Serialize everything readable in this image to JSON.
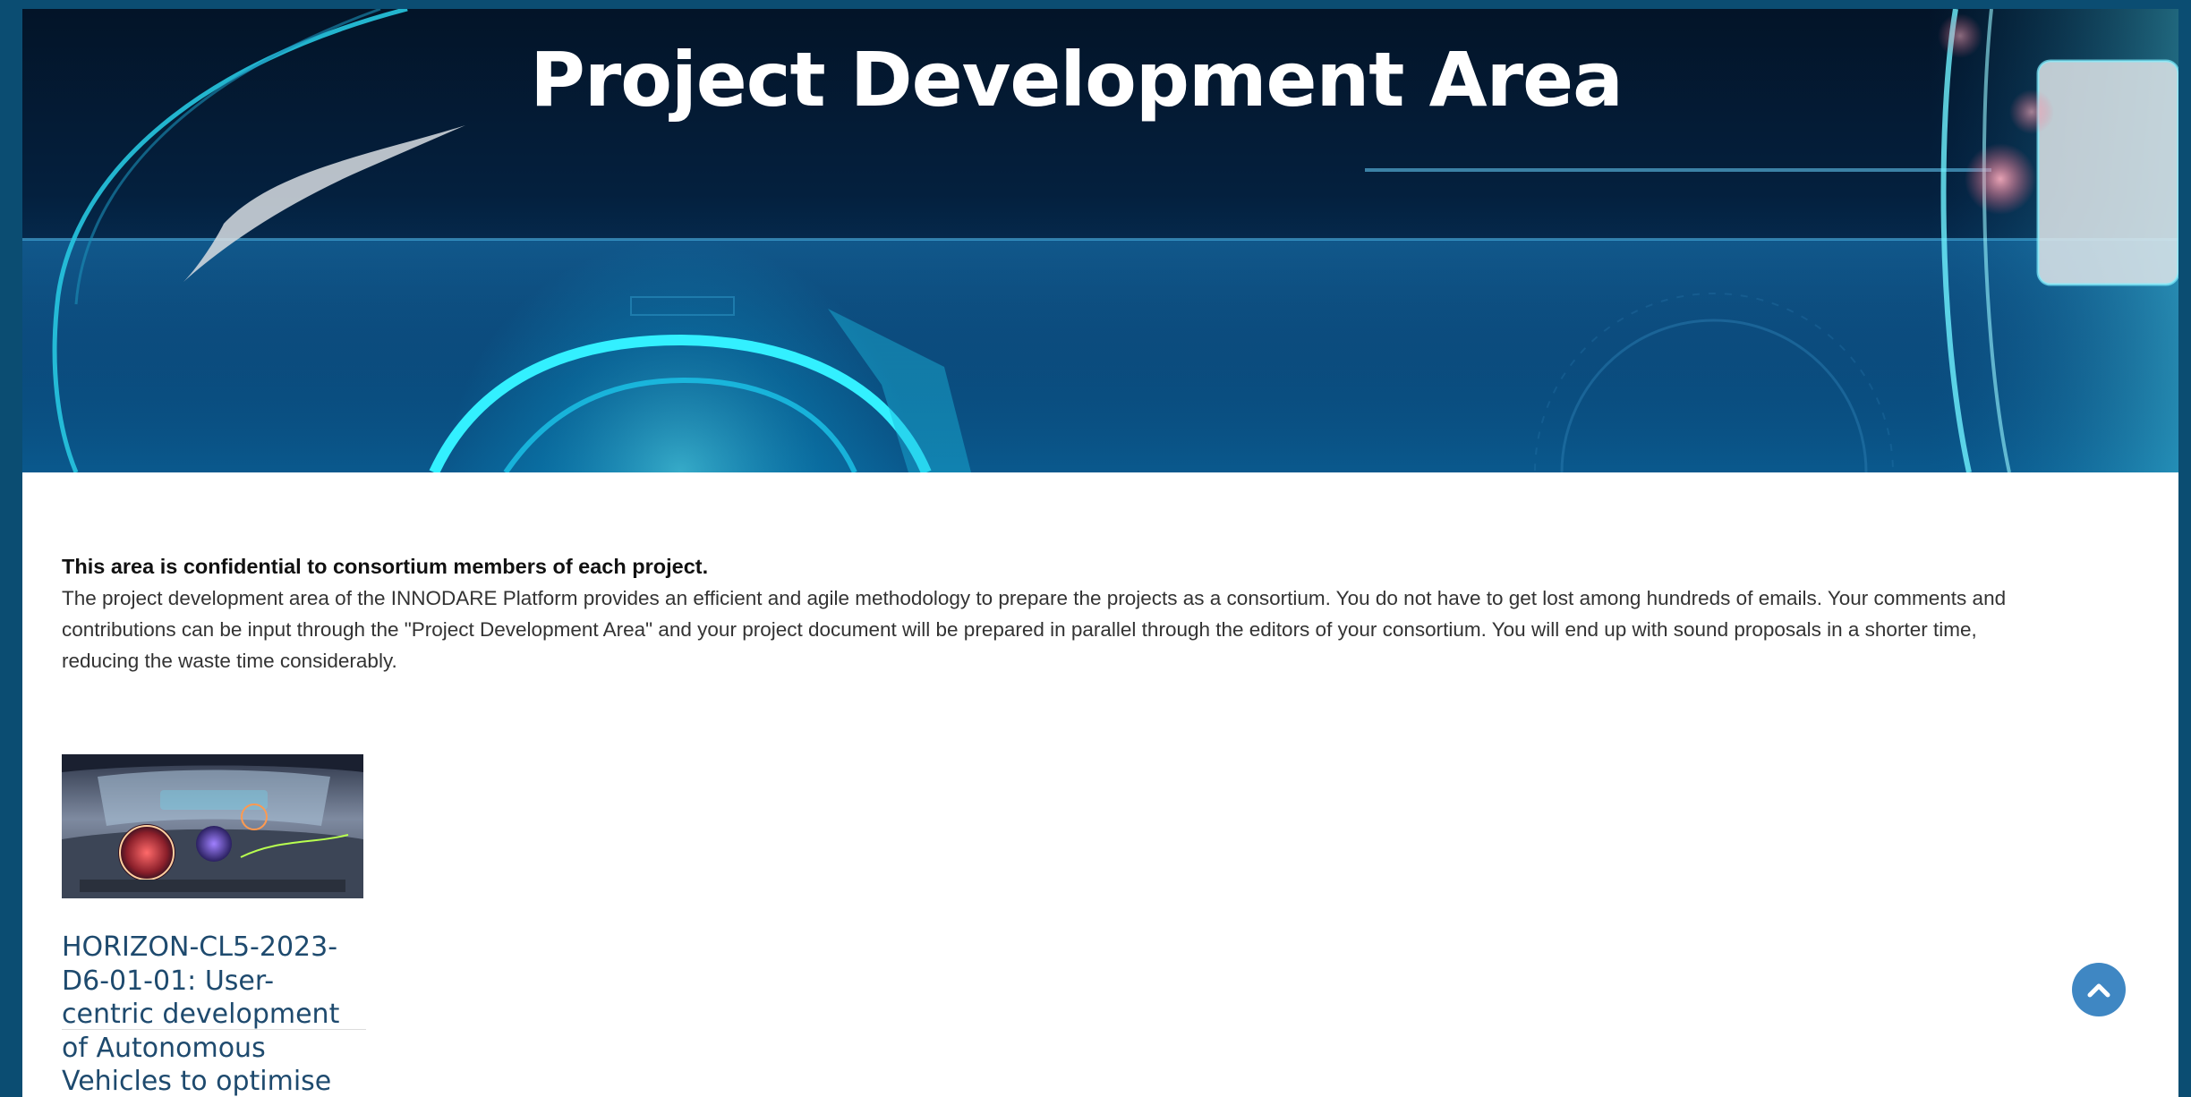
{
  "hero": {
    "title": "Project Development Area"
  },
  "intro": {
    "heading": "This area is confidential to consortium members of each project.",
    "body": "The project development area of the INNODARE Platform provides an efficient and agile methodology to prepare the projects as a consortium. You do not have to get lost among hundreds of emails. Your comments and contributions can be input through the \"Project Development Area\" and your project document will be prepared in parallel through the editors of your consortium.  You will end up with sound proposals in a shorter time, reducing the waste time considerably."
  },
  "cards": [
    {
      "title": "HORIZON-CL5-2023-D6-01-01: User-centric development of Autonomous Vehicles to optimise"
    }
  ],
  "scroll_top": {
    "icon": "chevron-up-icon"
  },
  "colors": {
    "frame": "#0b4d72",
    "card_title": "#1e4a6e",
    "scroll_button": "#3f87c3"
  }
}
